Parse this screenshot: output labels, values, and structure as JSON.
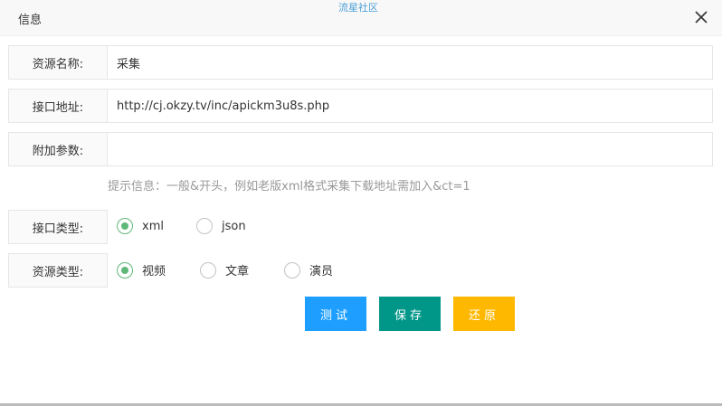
{
  "dialog": {
    "title": "信息",
    "watermark": "流星社区"
  },
  "form": {
    "resource_name": {
      "label": "资源名称:",
      "value": "采集"
    },
    "api_url": {
      "label": "接口地址:",
      "value": "http://cj.okzy.tv/inc/apickm3u8s.php"
    },
    "extra_params": {
      "label": "附加参数:",
      "value": ""
    },
    "hint": "提示信息：一般&开头，例如老版xml格式采集下载地址需加入&ct=1",
    "api_type": {
      "label": "接口类型:",
      "options": [
        "xml",
        "json"
      ],
      "selected": "xml"
    },
    "resource_type": {
      "label": "资源类型:",
      "options": [
        "视频",
        "文章",
        "演员"
      ],
      "selected": "视频"
    }
  },
  "buttons": {
    "test": "测试",
    "save": "保存",
    "reset": "还原"
  },
  "colors": {
    "radio_checked": "#5fb878",
    "test_button": "#1e9fff",
    "save_button": "#009688",
    "reset_button": "#ffb800",
    "watermark": "#4a9fd8"
  },
  "icons": {
    "close": "close-icon"
  }
}
